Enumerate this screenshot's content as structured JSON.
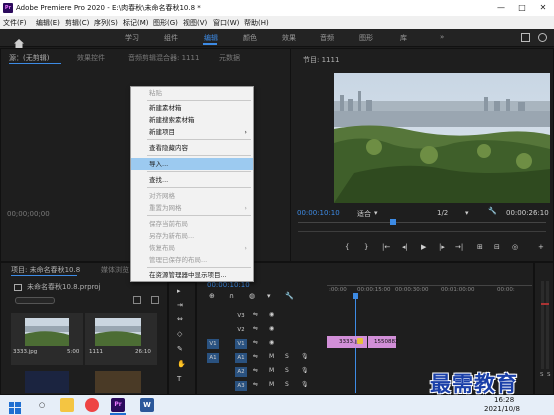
{
  "window": {
    "title": "Adobe Premiere Pro 2020 - E:\\肉春秋\\未命名春秋10.8 *",
    "logo_text": "Pr",
    "controls": [
      "—",
      "□",
      "✕"
    ]
  },
  "menu": [
    "文件(F)",
    "编辑(E)",
    "剪辑(C)",
    "序列(S)",
    "标记(M)",
    "图形(G)",
    "视图(V)",
    "窗口(W)",
    "帮助(H)"
  ],
  "workspaces": {
    "tabs": [
      "学习",
      "组件",
      "编辑",
      "颜色",
      "效果",
      "音频",
      "图形",
      "库"
    ],
    "active": "编辑",
    "overflow": "»"
  },
  "source_panel": {
    "tabs": [
      "源：(无剪辑)",
      "效果控件",
      "音频剪辑混合器: 1111",
      "元数据"
    ],
    "timecode": "00;00;00;00"
  },
  "program_panel": {
    "title": "节目: 1111",
    "timecode": "00:00:10:10",
    "fit": "适合",
    "ratio": "1/2",
    "duration": "00:00:26:10"
  },
  "context_menu": {
    "items": [
      {
        "label": "粘贴",
        "disabled": true
      },
      {
        "label": "新建素材箱",
        "disabled": false
      },
      {
        "label": "新建搜索素材箱",
        "disabled": false
      },
      {
        "label": "新建项目",
        "disabled": false,
        "submenu": true
      },
      {
        "label": "查看隐藏内容",
        "disabled": false
      },
      {
        "label": "导入...",
        "disabled": false,
        "highlighted": true
      },
      {
        "label": "查找...",
        "disabled": false
      },
      {
        "label": "对齐网格",
        "disabled": true
      },
      {
        "label": "重置为网格",
        "disabled": true,
        "submenu": true
      },
      {
        "label": "保存当前布局",
        "disabled": true
      },
      {
        "label": "另存为新布局...",
        "disabled": true
      },
      {
        "label": "恢复布局",
        "disabled": true,
        "submenu": true
      },
      {
        "label": "管理已保存的布局...",
        "disabled": true
      },
      {
        "label": "在资源管理器中显示项目...",
        "disabled": false
      }
    ]
  },
  "project_panel": {
    "tabs": [
      "项目: 未命名春秋10.8",
      "媒体浏览"
    ],
    "file": "未命名春秋10.8.prproj",
    "clips": [
      {
        "name": "3333.jpg",
        "duration": "5:00"
      },
      {
        "name": "1111",
        "duration": "26:10"
      }
    ]
  },
  "timeline": {
    "timecode": "00:00:10:10",
    "ruler": [
      ":00:00",
      "00:00:15:00",
      "00:00:30:00",
      "00:01:00:00",
      "00:00:"
    ],
    "video_tracks": [
      "V3",
      "V2",
      "V1"
    ],
    "audio_tracks": [
      "A1",
      "A2",
      "A3"
    ],
    "source_patch": [
      "V1",
      "A1"
    ],
    "track_buttons": {
      "mute": "M",
      "solo": "S"
    },
    "clips": [
      {
        "name": "3333.jp",
        "color": "#d28fd8"
      },
      {
        "name": "1550882",
        "color": "#d28fd8"
      }
    ],
    "audio_meter": [
      "S",
      "S"
    ]
  },
  "taskbar": {
    "time": "16:28",
    "date": "2021/10/8"
  },
  "watermark": "最需教育",
  "colors": {
    "accent": "#3d8be5",
    "clip": "#d28fd8",
    "highlight": "#9ccaf0"
  }
}
